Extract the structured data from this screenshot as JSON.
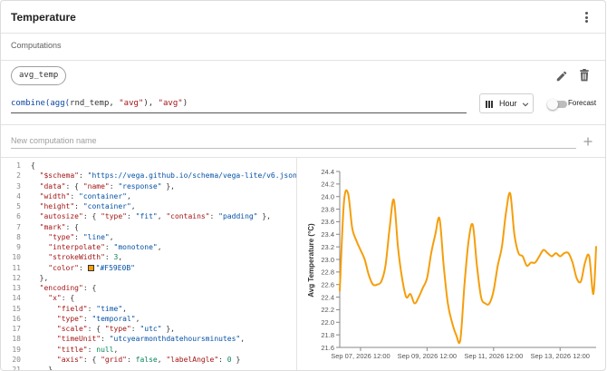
{
  "header": {
    "title": "Temperature",
    "menu_icon": "more-vert-icon"
  },
  "computations": {
    "section_title": "Computations",
    "chip_label": "avg_temp",
    "formula": {
      "fn1": "combine(",
      "fn2": "agg(",
      "field": "rnd_temp, ",
      "arg1": "\"avg\"",
      "close1": "), ",
      "arg2": "\"avg\"",
      "close2": ")"
    },
    "interval_label": "Hour",
    "forecast_label": "Forecast",
    "new_placeholder": "New computation name",
    "icons": [
      "edit-icon",
      "delete-icon",
      "add-icon",
      "bar-chart-icon",
      "chevron-down-icon"
    ]
  },
  "editor": {
    "lines": [
      {
        "n": "1",
        "t": "{"
      },
      {
        "n": "2",
        "k": "\"$schema\"",
        "t2": ": ",
        "s": "\"https://vega.github.io/schema/vega-lite/v6.json\"",
        "t3": ",",
        "i": 1
      },
      {
        "n": "3",
        "k": "\"data\"",
        "t2": ": { ",
        "k2": "\"name\"",
        "t4": ": ",
        "s": "\"response\"",
        "t3": " },",
        "i": 1
      },
      {
        "n": "4",
        "k": "\"width\"",
        "t2": ": ",
        "s": "\"container\"",
        "t3": ",",
        "i": 1
      },
      {
        "n": "5",
        "k": "\"height\"",
        "t2": ": ",
        "s": "\"container\"",
        "t3": ",",
        "i": 1
      },
      {
        "n": "6",
        "k": "\"autosize\"",
        "t2": ": { ",
        "k2": "\"type\"",
        "t4": ": ",
        "s": "\"fit\"",
        "t5": ", ",
        "k3": "\"contains\"",
        "t6": ": ",
        "s2": "\"padding\"",
        "t3": " },",
        "i": 1
      },
      {
        "n": "7",
        "k": "\"mark\"",
        "t2": ": {",
        "i": 1
      },
      {
        "n": "8",
        "k": "\"type\"",
        "t2": ": ",
        "s": "\"line\"",
        "t3": ",",
        "i": 2
      },
      {
        "n": "9",
        "k": "\"interpolate\"",
        "t2": ": ",
        "s": "\"monotone\"",
        "t3": ",",
        "i": 2
      },
      {
        "n": "10",
        "k": "\"strokeWidth\"",
        "t2": ": ",
        "num": "3",
        "t3": ",",
        "i": 2
      },
      {
        "n": "11",
        "k": "\"color\"",
        "t2": ": ",
        "color": "#F59E0B",
        "s": "\"#F59E0B\"",
        "i": 2
      },
      {
        "n": "12",
        "t": "},",
        "i": 1
      },
      {
        "n": "13",
        "k": "\"encoding\"",
        "t2": ": {",
        "i": 1
      },
      {
        "n": "14",
        "k": "\"x\"",
        "t2": ": {",
        "i": 2
      },
      {
        "n": "15",
        "k": "\"field\"",
        "t2": ": ",
        "s": "\"time\"",
        "t3": ",",
        "i": 3
      },
      {
        "n": "16",
        "k": "\"type\"",
        "t2": ": ",
        "s": "\"temporal\"",
        "t3": ",",
        "i": 3
      },
      {
        "n": "17",
        "k": "\"scale\"",
        "t2": ": { ",
        "k2": "\"type\"",
        "t4": ": ",
        "s": "\"utc\"",
        "t3": " },",
        "i": 3
      },
      {
        "n": "18",
        "k": "\"timeUnit\"",
        "t2": ": ",
        "s": "\"utcyearmonthdatehoursminutes\"",
        "t3": ",",
        "i": 3
      },
      {
        "n": "19",
        "k": "\"title\"",
        "t2": ": ",
        "num": "null",
        "t3": ",",
        "i": 3
      },
      {
        "n": "20",
        "k": "\"axis\"",
        "t2": ": { ",
        "k2": "\"grid\"",
        "t4": ": ",
        "num": "false",
        "t5": ", ",
        "k3": "\"labelAngle\"",
        "t6": ": ",
        "num2": "0",
        "t3": " }",
        "i": 3
      },
      {
        "n": "21",
        "t": "},",
        "i": 2
      }
    ]
  },
  "chart_data": {
    "type": "line",
    "ylabel": "Avg Temperature (°C)",
    "color": "#F59E0B",
    "ylim": [
      21.6,
      24.4
    ],
    "yticks": [
      "21.6",
      "21.8",
      "22.0",
      "22.2",
      "22.4",
      "22.6",
      "22.8",
      "23.0",
      "23.2",
      "23.4",
      "23.6",
      "23.8",
      "24.0",
      "24.2",
      "24.4"
    ],
    "xticks": [
      "Sep 07, 2026 12:00",
      "Sep 09, 2026 12:00",
      "Sep 11, 2026 12:00",
      "Sep 13, 2026 12:00"
    ],
    "x_start": "2026-09-06T21:00",
    "x_end": "2026-09-14T14:00",
    "x": [
      "2026-09-06T21:00",
      "2026-09-07T00:00",
      "2026-09-07T03:00",
      "2026-09-07T06:00",
      "2026-09-07T09:00",
      "2026-09-07T12:00",
      "2026-09-07T15:00",
      "2026-09-07T18:00",
      "2026-09-07T21:00",
      "2026-09-08T00:00",
      "2026-09-08T03:00",
      "2026-09-08T06:00",
      "2026-09-08T09:00",
      "2026-09-08T12:00",
      "2026-09-08T15:00",
      "2026-09-08T18:00",
      "2026-09-08T21:00",
      "2026-09-09T00:00",
      "2026-09-09T03:00",
      "2026-09-09T06:00",
      "2026-09-09T09:00",
      "2026-09-09T12:00",
      "2026-09-09T15:00",
      "2026-09-09T18:00",
      "2026-09-09T21:00",
      "2026-09-10T00:00",
      "2026-09-10T03:00",
      "2026-09-10T06:00",
      "2026-09-10T09:00",
      "2026-09-10T12:00",
      "2026-09-10T15:00",
      "2026-09-10T18:00",
      "2026-09-10T21:00",
      "2026-09-11T00:00",
      "2026-09-11T03:00",
      "2026-09-11T06:00",
      "2026-09-11T09:00",
      "2026-09-11T12:00",
      "2026-09-11T15:00",
      "2026-09-11T18:00",
      "2026-09-11T21:00",
      "2026-09-12T00:00",
      "2026-09-12T03:00",
      "2026-09-12T06:00",
      "2026-09-12T09:00",
      "2026-09-12T12:00",
      "2026-09-12T15:00",
      "2026-09-12T18:00",
      "2026-09-12T21:00",
      "2026-09-13T00:00",
      "2026-09-13T03:00",
      "2026-09-13T06:00",
      "2026-09-13T09:00",
      "2026-09-13T12:00",
      "2026-09-13T15:00",
      "2026-09-13T18:00",
      "2026-09-13T21:00",
      "2026-09-14T00:00",
      "2026-09-14T03:00",
      "2026-09-14T06:00",
      "2026-09-14T09:00",
      "2026-09-14T12:00",
      "2026-09-14T14:00"
    ],
    "values": [
      22.5,
      23.9,
      24.05,
      23.5,
      23.3,
      23.15,
      23.0,
      22.75,
      22.6,
      22.6,
      22.65,
      22.9,
      23.5,
      23.95,
      23.2,
      22.7,
      22.4,
      22.45,
      22.3,
      22.4,
      22.55,
      22.7,
      23.1,
      23.4,
      23.65,
      22.9,
      22.3,
      22.0,
      21.8,
      21.72,
      22.6,
      23.3,
      23.55,
      22.9,
      22.4,
      22.3,
      22.3,
      22.5,
      22.9,
      23.2,
      23.75,
      24.05,
      23.4,
      23.1,
      23.05,
      22.9,
      22.95,
      22.95,
      23.05,
      23.15,
      23.1,
      23.05,
      23.1,
      23.05,
      23.1,
      23.1,
      22.95,
      22.7,
      22.65,
      22.95,
      23.05,
      22.45,
      23.2
    ]
  }
}
